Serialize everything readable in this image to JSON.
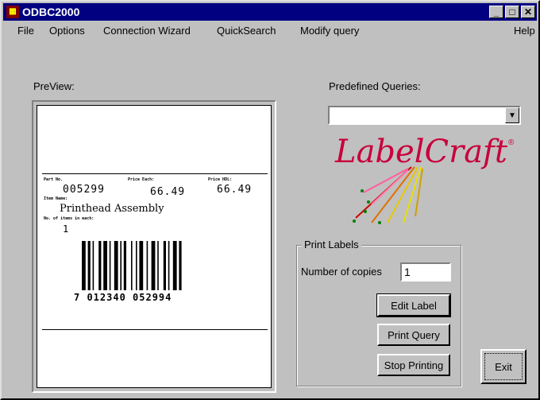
{
  "window": {
    "title": "ODBC2000",
    "icon": "app-icon",
    "buttons": {
      "minimize": "_",
      "maximize": "□",
      "close": "✕"
    }
  },
  "menu": {
    "file": "File",
    "options": "Options",
    "connection_wizard": "Connection Wizard",
    "quicksearch": "QuickSearch",
    "modify_query": "Modify query",
    "help": "Help"
  },
  "preview": {
    "label": "PreView:",
    "label_fields": {
      "part_no_title": "Part No.",
      "part_no_value": "005299",
      "price_each_title": "Price Each:",
      "price_each_value": "66.49",
      "price_hdl_title": "Price HDL:",
      "price_hdl_value": "66.49",
      "item_name_title": "Item Name:",
      "item_name_value": "Printhead Assembly",
      "no_items_title": "No. of items in each:",
      "no_items_value": "1",
      "barcode_text": "7 012340 052994"
    }
  },
  "predefined": {
    "label": "Predefined Queries:",
    "selected": ""
  },
  "logo": {
    "text": "LabelCraft",
    "mark": "®",
    "color": "#c8003c"
  },
  "print": {
    "group_title": "Print Labels",
    "copies_label": "Number of copies",
    "copies_value": "1",
    "edit_label": "Edit Label",
    "print_query": "Print Query",
    "stop_printing": "Stop Printing"
  },
  "exit_label": "Exit"
}
